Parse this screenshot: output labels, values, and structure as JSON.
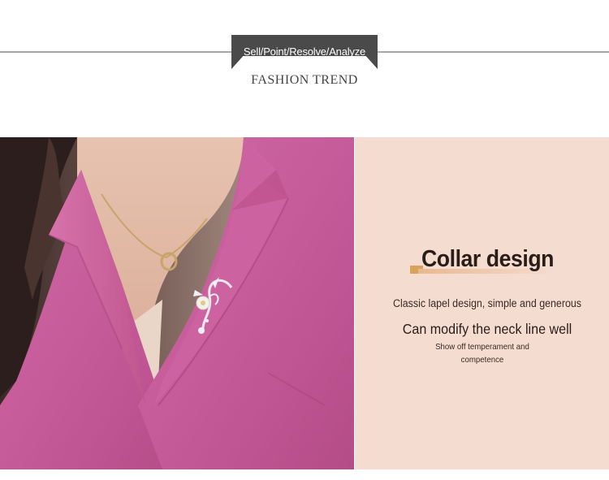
{
  "header": {
    "tab_label": "Sell/Point/Resolve/Analyze",
    "subtitle": "FASHION TREND"
  },
  "feature": {
    "title": "Collar design",
    "line1": "Classic lapel design, simple and generous",
    "line2": "Can modify the neck line well",
    "line3": "Show off temperament and competence"
  },
  "colors": {
    "panel_bg": "#f5dcd0",
    "blazer": "#c95a9c",
    "tab_bg": "#4a4a4a",
    "accent": "#d9a25a"
  },
  "image": {
    "icon": "model-photo-pink-blazer-brooch"
  }
}
